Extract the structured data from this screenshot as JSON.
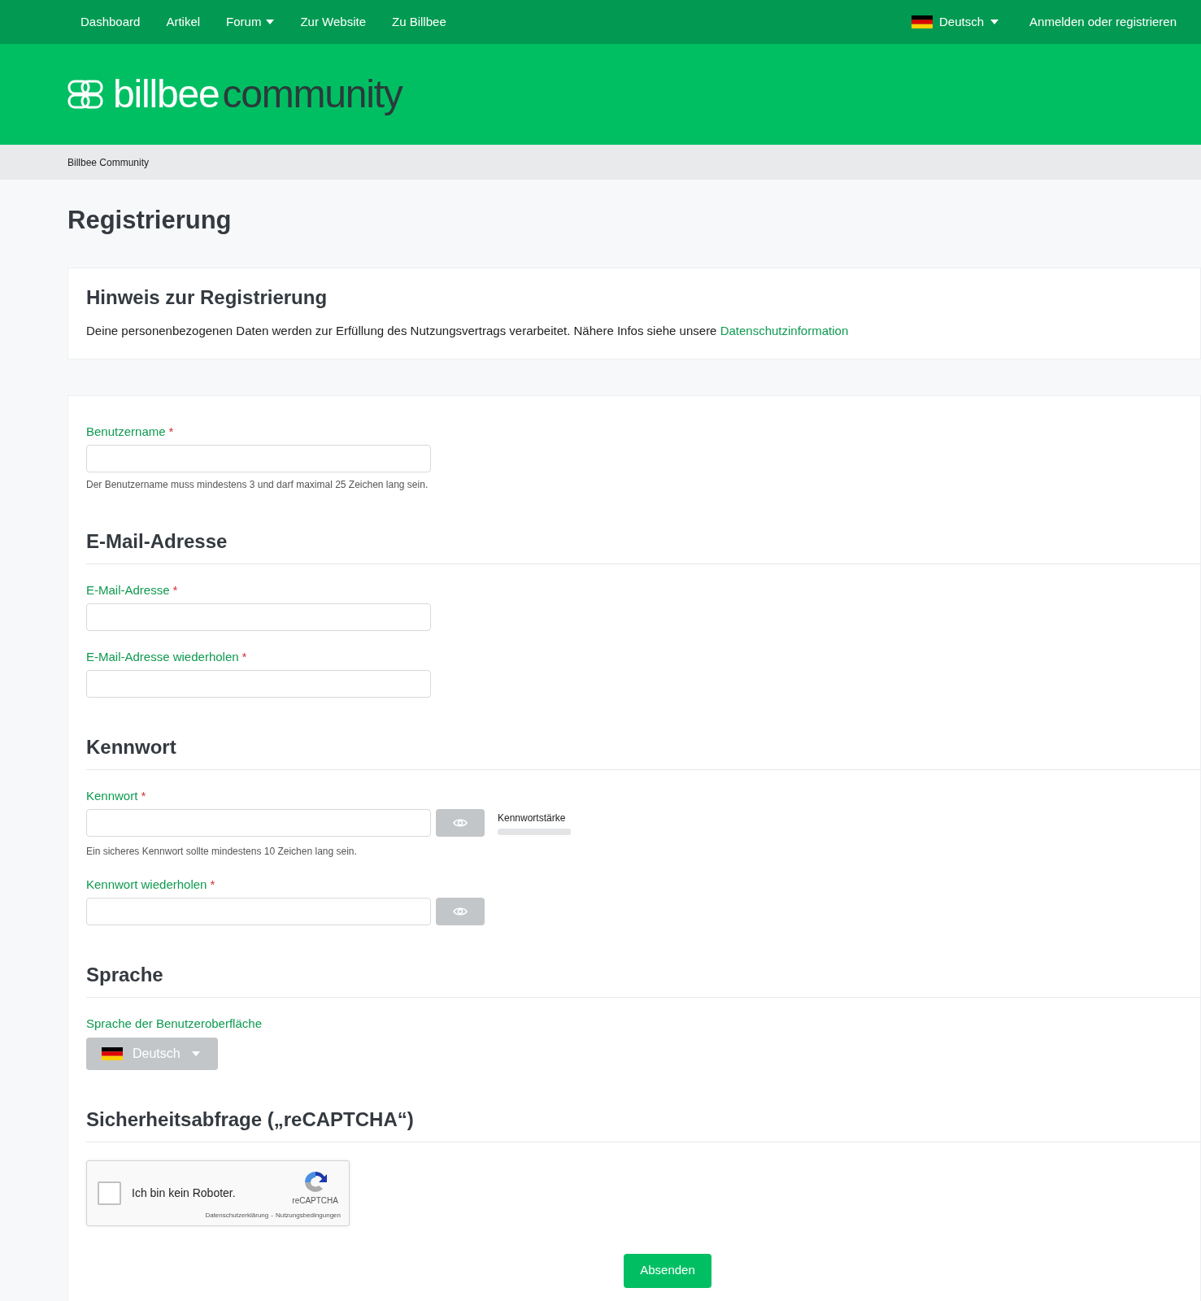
{
  "nav": {
    "items": [
      {
        "label": "Dashboard",
        "dropdown": false
      },
      {
        "label": "Artikel",
        "dropdown": false
      },
      {
        "label": "Forum",
        "dropdown": true
      },
      {
        "label": "Zur Website",
        "dropdown": false
      },
      {
        "label": "Zu Billbee",
        "dropdown": false
      }
    ],
    "language": {
      "label": "Deutsch",
      "dropdown": true
    },
    "login": "Anmelden oder registrieren"
  },
  "logo": {
    "brand": "billbee",
    "suffix": "community"
  },
  "breadcrumb": [
    "Billbee Community"
  ],
  "page_title": "Registrierung",
  "notice": {
    "title": "Hinweis zur Registrierung",
    "text": "Deine personenbezogenen Daten werden zur Erfüllung des Nutzungsvertrags verarbeitet. Nähere Infos siehe unsere",
    "link": "Datenschutzinformation"
  },
  "required_mark": "*",
  "sections": [
    {
      "fields": [
        {
          "kind": "text",
          "label": "Benutzername",
          "required": true,
          "hint": "Der Benutzername muss mindestens 3 und darf maximal 25 Zeichen lang sein."
        }
      ]
    },
    {
      "heading": "E-Mail-Adresse",
      "fields": [
        {
          "kind": "text",
          "label": "E-Mail-Adresse",
          "required": true
        },
        {
          "kind": "text",
          "label": "E-Mail-Adresse wiederholen",
          "required": true
        }
      ]
    },
    {
      "heading": "Kennwort",
      "fields": [
        {
          "kind": "password",
          "label": "Kennwort",
          "required": true,
          "strength": {
            "label": "Kennwortstärke",
            "level": 0
          },
          "hint": "Ein sicheres Kennwort sollte mindestens 10 Zeichen lang sein."
        },
        {
          "kind": "password",
          "label": "Kennwort wiederholen",
          "required": true
        }
      ]
    },
    {
      "heading": "Sprache",
      "fields": [
        {
          "kind": "language",
          "label": "Sprache der Benutzeroberfläche",
          "value": "Deutsch"
        }
      ]
    },
    {
      "heading": "Sicherheitsabfrage („reCAPTCHA“)",
      "fields": [
        {
          "kind": "captcha",
          "label": "Ich bin kein Roboter.",
          "checked": false,
          "brand": "reCAPTCHA",
          "links": [
            "Datenschutzerklärung",
            "Nutzungsbedingungen"
          ],
          "separator": "-"
        }
      ]
    }
  ],
  "submit": "Absenden"
}
